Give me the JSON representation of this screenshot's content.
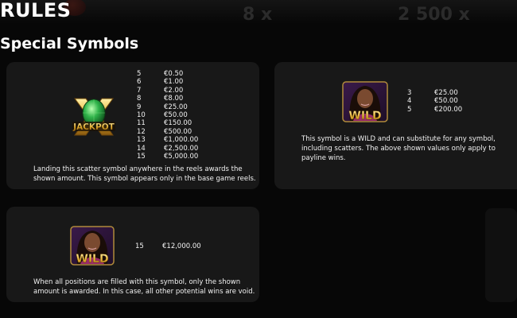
{
  "header": {
    "title": "RULES",
    "ghost_text_1": "8 x",
    "ghost_text_2": "2 500 x"
  },
  "section": {
    "title": "Special Symbols"
  },
  "cards": [
    {
      "symbol": "jackpot-symbol",
      "symbol_text": "JACKPOT",
      "paytable": [
        {
          "count": "5",
          "value": "€0.50"
        },
        {
          "count": "6",
          "value": "€1.00"
        },
        {
          "count": "7",
          "value": "€2.00"
        },
        {
          "count": "8",
          "value": "€8.00"
        },
        {
          "count": "9",
          "value": "€25.00"
        },
        {
          "count": "10",
          "value": "€50.00"
        },
        {
          "count": "11",
          "value": "€150.00"
        },
        {
          "count": "12",
          "value": "€500.00"
        },
        {
          "count": "13",
          "value": "€1,000.00"
        },
        {
          "count": "14",
          "value": "€2,500.00"
        },
        {
          "count": "15",
          "value": "€5,000.00"
        }
      ],
      "description": "Landing this scatter symbol anywhere in the reels awards the shown amount. This symbol appears only in the base game reels."
    },
    {
      "symbol": "wild-symbol",
      "symbol_text": "WILD",
      "paytable": [
        {
          "count": "3",
          "value": "€25.00"
        },
        {
          "count": "4",
          "value": "€50.00"
        },
        {
          "count": "5",
          "value": "€200.00"
        }
      ],
      "description": "This symbol is a WILD and can substitute for any symbol, including scatters. The above shown values only apply to payline wins."
    },
    {
      "symbol": "wild-symbol",
      "symbol_text": "WILD",
      "paytable": [
        {
          "count": "15",
          "value": "€12,000.00"
        }
      ],
      "description": "When all positions are filled with this symbol, only the shown amount is awarded. In this case, all other potential wins are void."
    }
  ],
  "colors": {
    "card_bg": "#181818",
    "gold": "#e8b73a",
    "emerald": "#2fb34a"
  }
}
